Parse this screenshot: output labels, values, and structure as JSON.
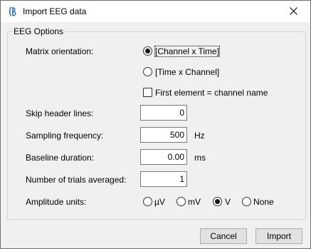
{
  "window": {
    "title": "Import EEG data",
    "app_icon": "brainstorm-logo-icon"
  },
  "group": {
    "title": "EEG Options"
  },
  "matrix": {
    "label": "Matrix orientation:",
    "options": [
      {
        "label": "[Channel x Time]",
        "selected": true
      },
      {
        "label": "[Time x Channel]",
        "selected": false
      }
    ],
    "first_element": {
      "label": "First element = channel name",
      "checked": false
    }
  },
  "fields": {
    "skip_header": {
      "label": "Skip header lines:",
      "value": "0",
      "unit": ""
    },
    "sampling": {
      "label": "Sampling frequency:",
      "value": "500",
      "unit": "Hz"
    },
    "baseline": {
      "label": "Baseline duration:",
      "value": "0.00",
      "unit": "ms"
    },
    "trials": {
      "label": "Number of trials averaged:",
      "value": "1",
      "unit": ""
    }
  },
  "amplitude": {
    "label": "Amplitude units:",
    "options": [
      {
        "label": "µV",
        "selected": false
      },
      {
        "label": "mV",
        "selected": false
      },
      {
        "label": "V",
        "selected": true
      },
      {
        "label": "None",
        "selected": false
      }
    ]
  },
  "buttons": {
    "cancel": "Cancel",
    "import": "Import"
  }
}
